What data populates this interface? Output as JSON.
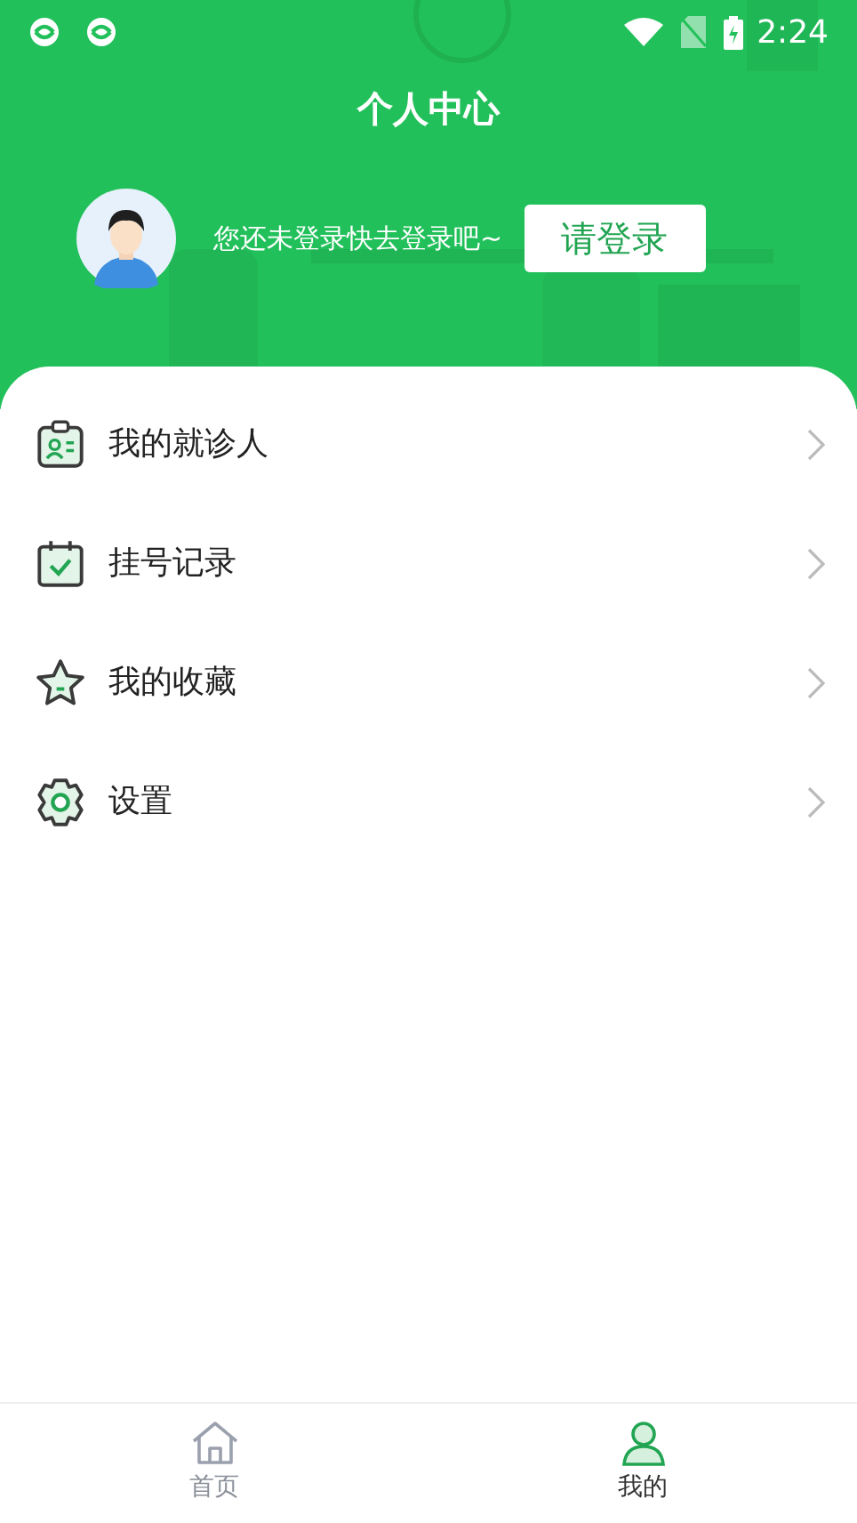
{
  "status_bar": {
    "time": "2:24"
  },
  "header": {
    "title": "个人中心",
    "prompt": "您还未登录快去登录吧~",
    "login_button": "请登录"
  },
  "menu": [
    {
      "kind": "patient",
      "label": "我的就诊人"
    },
    {
      "kind": "record",
      "label": "挂号记录"
    },
    {
      "kind": "favorite",
      "label": "我的收藏"
    },
    {
      "kind": "settings",
      "label": "设置"
    }
  ],
  "tabs": [
    {
      "kind": "home",
      "label": "首页",
      "selected": false
    },
    {
      "kind": "mine",
      "label": "我的",
      "selected": true
    }
  ]
}
